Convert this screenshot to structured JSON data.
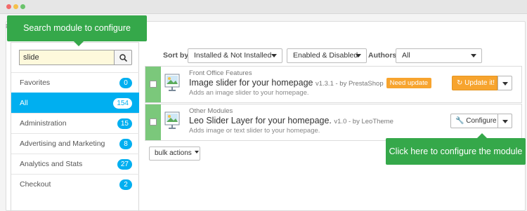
{
  "tooltips": {
    "search": "Search module to configure",
    "configure": "Click here to configure the module"
  },
  "search": {
    "value": "slide"
  },
  "categories": [
    {
      "label": "Favorites",
      "count": "0",
      "active": false
    },
    {
      "label": "All",
      "count": "154",
      "active": true
    },
    {
      "label": "Administration",
      "count": "15",
      "active": false
    },
    {
      "label": "Advertising and Marketing",
      "count": "8",
      "active": false
    },
    {
      "label": "Analytics and Stats",
      "count": "27",
      "active": false
    },
    {
      "label": "Checkout",
      "count": "2",
      "active": false
    }
  ],
  "filters": {
    "sort_by_label": "Sort by",
    "install_filter": "Installed & Not Installed",
    "status_filter": "Enabled & Disabled",
    "authors_label": "Authors",
    "authors_filter": "All"
  },
  "modules": [
    {
      "category": "Front Office Features",
      "name": "Image slider for your homepage",
      "version": "v1.3.1 - by PrestaShop",
      "badge": "Need update",
      "description": "Adds an image slider to your homepage.",
      "action": "Update it!"
    },
    {
      "category": "Other Modules",
      "name": "Leo Slider Layer for your homepage.",
      "version": "v1.0 - by LeoTheme",
      "description": "Adds image or text slider to your homepage.",
      "action": "Configure"
    }
  ],
  "bulk_actions": "bulk actions",
  "colors": {
    "accent": "#00aff0",
    "tooltip": "#35a84a",
    "update": "#f7a42e",
    "strip": "#7bc87b"
  }
}
